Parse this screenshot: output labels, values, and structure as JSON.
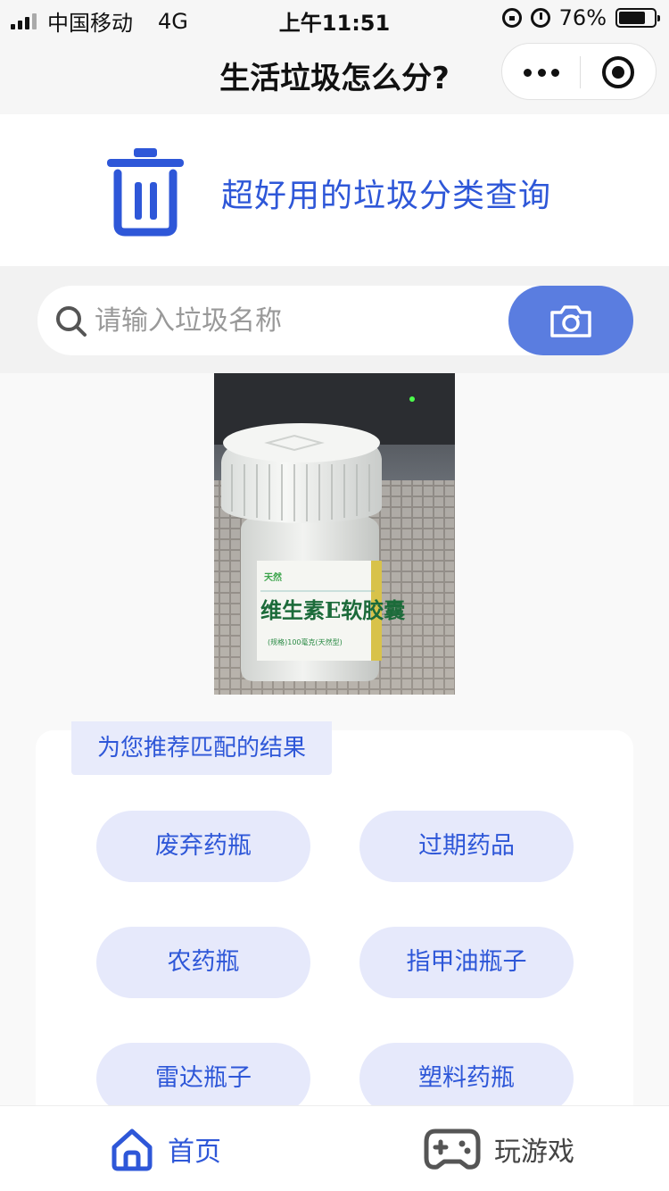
{
  "status_bar": {
    "carrier": "中国移动",
    "network": "4G",
    "time": "上午11:51",
    "battery": "76%",
    "battery_level": 0.76
  },
  "nav": {
    "title": "生活垃圾怎么分?"
  },
  "banner": {
    "icon": "trash-can-icon",
    "title": "超好用的垃圾分类查询"
  },
  "search": {
    "placeholder": "请输入垃圾名称",
    "value": ""
  },
  "photo": {
    "label_main": "维生素E软胶囊",
    "label_sub": "(规格)100毫克(天然型)"
  },
  "results": {
    "heading": "为您推荐匹配的结果",
    "items": [
      "废弃药瓶",
      "过期药品",
      "农药瓶",
      "指甲油瓶子",
      "雷达瓶子",
      "塑料药瓶"
    ]
  },
  "tabs": [
    {
      "label": "首页",
      "icon": "home-icon",
      "active": true
    },
    {
      "label": "玩游戏",
      "icon": "gamepad-icon",
      "active": false
    }
  ],
  "colors": {
    "accent": "#2e57d8",
    "button": "#5a7de0",
    "chip": "#e6e9fb"
  }
}
